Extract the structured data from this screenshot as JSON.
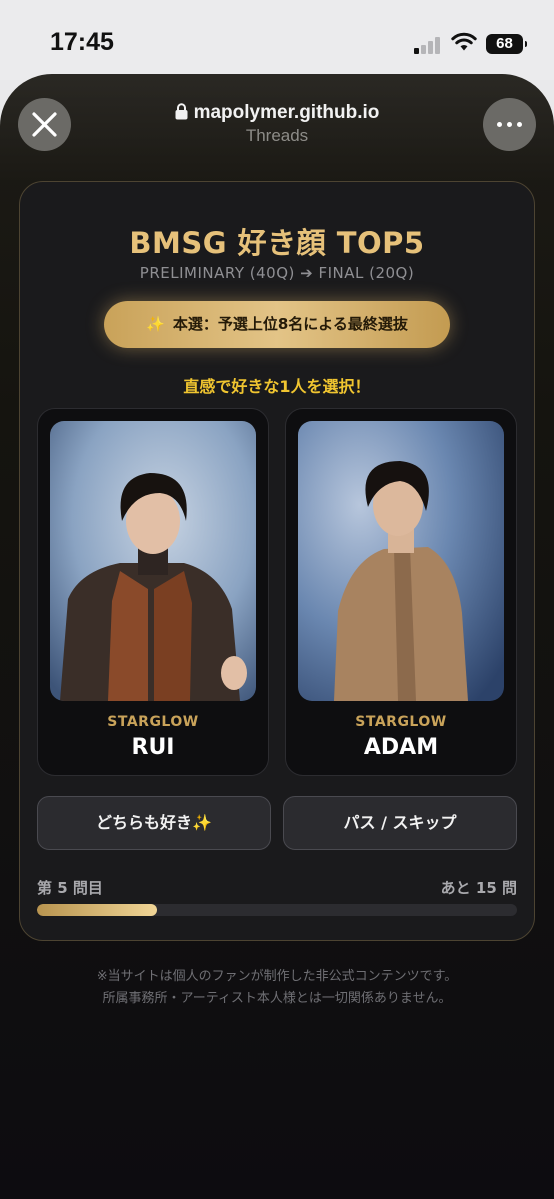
{
  "status_bar": {
    "time": "17:45",
    "battery": "68",
    "icons": [
      "signal-icon",
      "wifi-icon",
      "battery-icon"
    ]
  },
  "browser": {
    "url": "mapolymer.github.io",
    "source": "Threads",
    "close_icon": "close-icon",
    "more_icon": "more-icon",
    "lock_icon": "lock-icon"
  },
  "quiz": {
    "title": "BMSG 好き顔 TOP5",
    "subtitle": "PRELIMINARY (40Q) ➔ FINAL (20Q)",
    "stage_spark": "✨",
    "stage_badge": "本選：予選上位8名による最終選抜",
    "prompt": "直感で好きな1人を選択！",
    "choices": [
      {
        "group": "STARGLOW",
        "name": "RUI"
      },
      {
        "group": "STARGLOW",
        "name": "ADAM"
      }
    ],
    "both_button": "どちらも好き✨",
    "skip_button": "パス / スキップ",
    "progress_current": "第 5 問目",
    "progress_remaining": "あと 15 問",
    "progress_fraction": 0.25
  },
  "disclaimer": {
    "line1": "※当サイトは個人のファンが制作した非公式コンテンツです。",
    "line2": "所属事務所・アーティスト本人様とは一切関係ありません。"
  },
  "colors": {
    "accent_gold": "#e6c17a",
    "prompt_yellow": "#f0c530",
    "card_bg": "#1a1a1c"
  }
}
